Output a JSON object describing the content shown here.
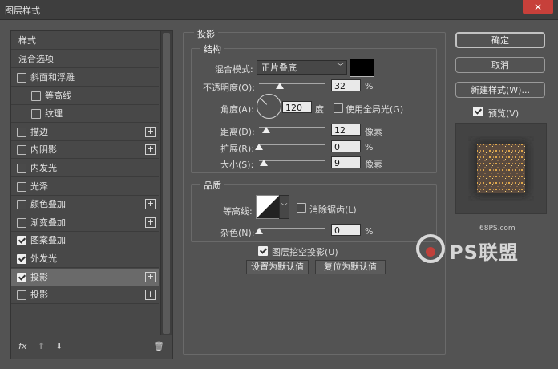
{
  "window": {
    "title": "图层样式",
    "close_glyph": "✕"
  },
  "style_list": {
    "header": "样式",
    "blend_options": "混合选项",
    "items": [
      {
        "label": "斜面和浮雕",
        "checked": false,
        "plus": false
      },
      {
        "label": "等高线",
        "checked": false,
        "plus": false
      },
      {
        "label": "纹理",
        "checked": false,
        "plus": false
      },
      {
        "label": "描边",
        "checked": false,
        "plus": true
      },
      {
        "label": "内阴影",
        "checked": false,
        "plus": true
      },
      {
        "label": "内发光",
        "checked": false,
        "plus": false
      },
      {
        "label": "光泽",
        "checked": false,
        "plus": false
      },
      {
        "label": "颜色叠加",
        "checked": false,
        "plus": true
      },
      {
        "label": "渐变叠加",
        "checked": false,
        "plus": true
      },
      {
        "label": "图案叠加",
        "checked": true,
        "plus": false
      },
      {
        "label": "外发光",
        "checked": true,
        "plus": false
      },
      {
        "label": "投影",
        "checked": true,
        "plus": true,
        "selected": true
      },
      {
        "label": "投影",
        "checked": false,
        "plus": true
      }
    ],
    "plus_glyph": "+",
    "bottom": {
      "fx": "fx",
      "up_glyph": "⬆",
      "down_glyph": "⬇",
      "trash_glyph": "🗑"
    }
  },
  "drop_shadow": {
    "section_title": "投影",
    "structure": {
      "title": "结构",
      "blend_mode_label": "混合模式:",
      "blend_mode_value": "正片叠底",
      "shadow_color": "#000000",
      "opacity_label": "不透明度(O):",
      "opacity_value": "32",
      "opacity_unit": "%",
      "angle_label": "角度(A):",
      "angle_value": "120",
      "angle_unit": "度",
      "global_light_label": "使用全局光(G)",
      "global_light_checked": false,
      "distance_label": "距离(D):",
      "distance_value": "12",
      "distance_unit": "像素",
      "spread_label": "扩展(R):",
      "spread_value": "0",
      "spread_unit": "%",
      "size_label": "大小(S):",
      "size_value": "9",
      "size_unit": "像素"
    },
    "quality": {
      "title": "品质",
      "contour_label": "等高线:",
      "antialias_label": "消除锯齿(L)",
      "antialias_checked": false,
      "noise_label": "杂色(N):",
      "noise_value": "0",
      "noise_unit": "%"
    },
    "layer_knockout_label": "图层挖空投影(U)",
    "layer_knockout_checked": true,
    "set_default_button": "设置为默认值",
    "reset_default_button": "复位为默认值"
  },
  "actions": {
    "ok": "确定",
    "cancel": "取消",
    "new_style": "新建样式(W)...",
    "preview_label": "预览(V)",
    "preview_checked": true
  },
  "watermark": {
    "site": "68PS.com",
    "brand": "PS联盟"
  },
  "colors": {
    "dialog_bg": "#535353",
    "close_red": "#c7403a",
    "list_selected": "#6a6a6a"
  }
}
